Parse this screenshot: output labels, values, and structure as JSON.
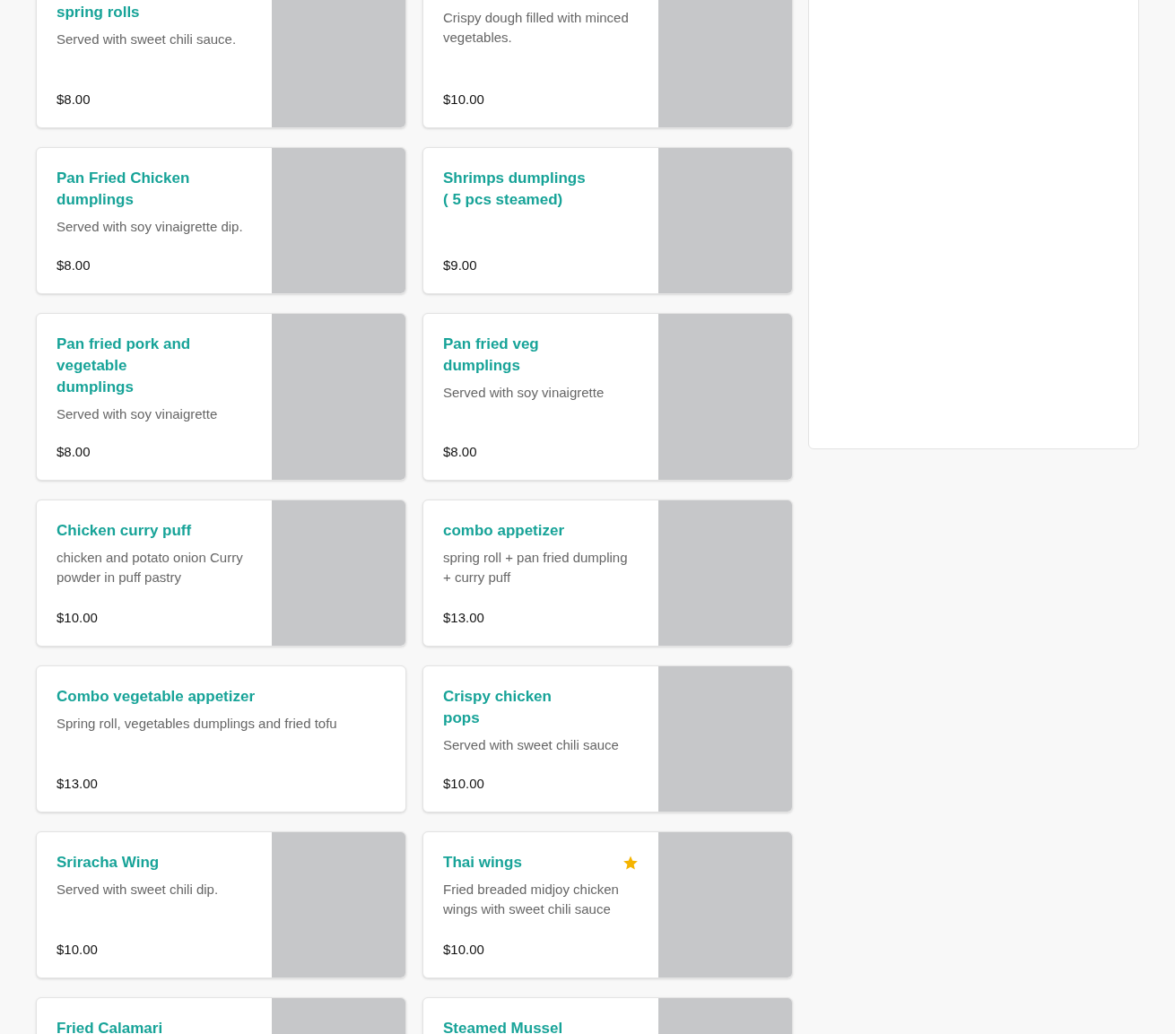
{
  "menu_items": [
    {
      "title": "spring rolls",
      "description": "Served with sweet chili sauce.",
      "price": "$8.00",
      "starred": false,
      "has_image": true
    },
    {
      "description": "Crispy dough filled with minced vegetables.",
      "price": "$10.00",
      "starred": false,
      "has_image": true
    },
    {
      "title": "Pan Fried Chicken dumplings",
      "description": "Served with soy vinaigrette dip.",
      "price": "$8.00",
      "starred": false,
      "has_image": true
    },
    {
      "title": "Shrimps dumplings ( 5 pcs steamed)",
      "price": "$9.00",
      "starred": false,
      "has_image": true
    },
    {
      "title": "Pan fried pork and vegetable dumplings",
      "description": "Served with soy vinaigrette",
      "price": "$8.00",
      "starred": false,
      "has_image": true
    },
    {
      "title": "Pan fried veg dumplings",
      "description": "Served with soy vinaigrette",
      "price": "$8.00",
      "starred": false,
      "has_image": true
    },
    {
      "title": "Chicken curry puff",
      "description": "chicken and potato onion Curry powder in puff pastry",
      "price": "$10.00",
      "starred": false,
      "has_image": true
    },
    {
      "title": "combo appetizer",
      "description": "spring roll + pan fried dumpling + curry puff",
      "price": "$13.00",
      "starred": false,
      "has_image": true
    },
    {
      "title": "Combo vegetable appetizer",
      "description": "Spring roll, vegetables dumplings and fried tofu",
      "price": "$13.00",
      "starred": false,
      "has_image": false
    },
    {
      "title": "Crispy chicken pops",
      "description": "Served with sweet chili sauce",
      "price": "$10.00",
      "starred": false,
      "has_image": true
    },
    {
      "title": "Sriracha Wing",
      "description": "Served with sweet chili dip.",
      "price": "$10.00",
      "starred": false,
      "has_image": true
    },
    {
      "title": "Thai wings",
      "description": "Fried breaded midjoy chicken wings with sweet chili sauce",
      "price": "$10.00",
      "starred": true,
      "has_image": true
    },
    {
      "title": "Fried Calamari",
      "starred": false,
      "has_image": true
    },
    {
      "title": "Steamed Mussel",
      "starred": false,
      "has_image": true
    }
  ]
}
